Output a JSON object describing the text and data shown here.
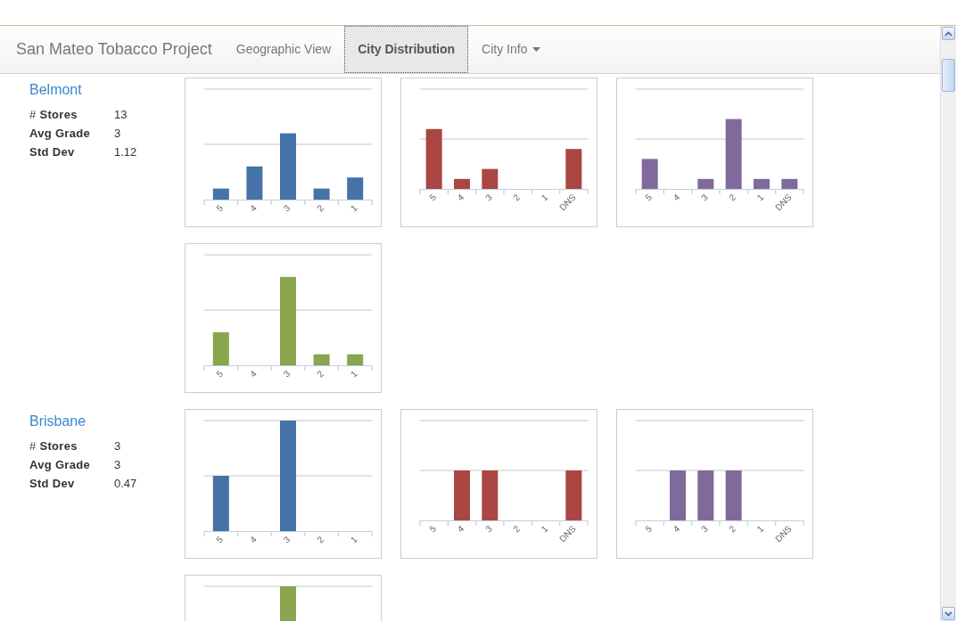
{
  "navbar": {
    "brand": "San Mateo Tobacco Project",
    "items": [
      {
        "label": "Geographic View",
        "selected": false,
        "dropdown": false
      },
      {
        "label": "City Distribution",
        "selected": true,
        "dropdown": false
      },
      {
        "label": "City Info",
        "selected": false,
        "dropdown": true
      }
    ]
  },
  "cities": [
    {
      "name": "Belmont",
      "stats": [
        {
          "label": "# **Stores**",
          "value": "13"
        },
        {
          "label": "Avg Grade",
          "value": "3"
        },
        {
          "label": "Std Dev",
          "value": "1.12"
        }
      ],
      "charts": [
        {
          "kind": "picture",
          "color": "#4572a7",
          "axis_labels": [
            "5",
            "4",
            "3",
            "2",
            "1"
          ]
        },
        {
          "kind": "picture",
          "color": "#aa4643",
          "axis_labels": [
            "5",
            "4",
            "3",
            "2",
            "1",
            "DNS"
          ]
        },
        {
          "kind": "picture",
          "color": "#80699b",
          "axis_labels": [
            "5",
            "4",
            "3",
            "2",
            "1",
            "DNS"
          ]
        },
        {
          "kind": "picture",
          "color": "#89a54e",
          "axis_labels": [
            "5",
            "4",
            "3",
            "2",
            "1"
          ]
        }
      ]
    },
    {
      "name": "Brisbane",
      "stats": [
        {
          "label": "# **Stores**",
          "value": "3"
        },
        {
          "label": "Avg Grade",
          "value": "3"
        },
        {
          "label": "Std Dev",
          "value": "0.47"
        }
      ],
      "charts": [
        {
          "kind": "picture",
          "color": "#4572a7",
          "axis_labels": [
            "5",
            "4",
            "3",
            "2",
            "1"
          ]
        },
        {
          "kind": "picture",
          "color": "#aa4643",
          "axis_labels": [
            "5",
            "4",
            "3",
            "2",
            "1",
            "DNS"
          ]
        },
        {
          "kind": "picture",
          "color": "#80699b",
          "axis_labels": [
            "5",
            "4",
            "3",
            "2",
            "1",
            "DNS"
          ]
        },
        {
          "kind": "picture",
          "color": "#89a54e"
        }
      ]
    }
  ]
}
